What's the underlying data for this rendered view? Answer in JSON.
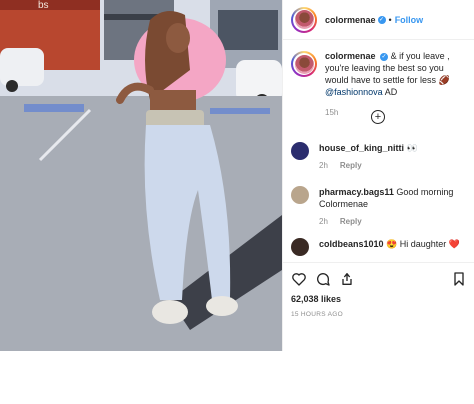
{
  "photo": {
    "sign_text": "bs"
  },
  "header": {
    "username": "colormenae",
    "verified": "✓",
    "separator": "•",
    "follow_label": "Follow"
  },
  "caption": {
    "username": "colormenae",
    "text": "& if you leave , you're leaving the best so you would have to settle for less",
    "emoji": "🏈",
    "mention": "@fashionnova",
    "suffix": "AD",
    "time": "15h"
  },
  "load_more": {
    "symbol": "+"
  },
  "comments": [
    {
      "username": "house_of_king_nitti",
      "text": "👀",
      "time": "",
      "reply": ""
    },
    {
      "username": "pharmacy.bags11",
      "text": "Good morning Colormenae",
      "time": "2h",
      "reply": "Reply"
    },
    {
      "username": "coldbeans1010",
      "text": "😍 Hi daughter ❤️",
      "time": "",
      "reply": ""
    }
  ],
  "first_comment_meta": {
    "time": "2h",
    "reply": "Reply"
  },
  "likes": "62,038 likes",
  "posted": "15 HOURS AGO",
  "icons": [
    "heart-icon",
    "comment-icon",
    "share-icon",
    "bookmark-icon"
  ]
}
